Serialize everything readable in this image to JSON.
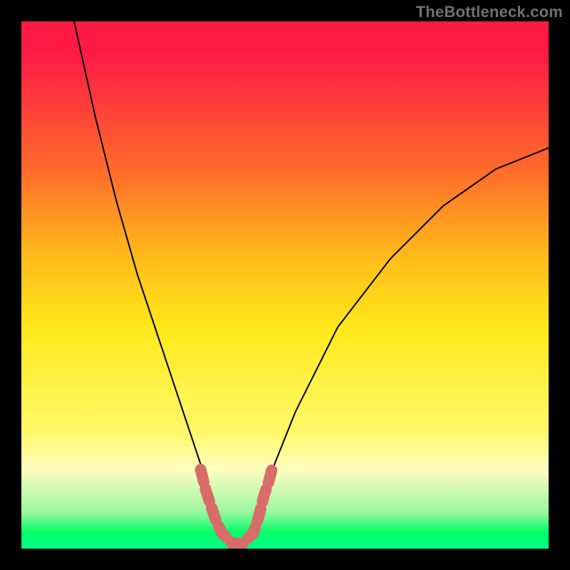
{
  "watermark": "TheBottleneck.com",
  "chart_data": {
    "type": "line",
    "title": "",
    "xlabel": "",
    "ylabel": "",
    "xlim": [
      0,
      100
    ],
    "ylim": [
      0,
      100
    ],
    "grid": false,
    "series": [
      {
        "name": "bottleneck-curve",
        "color": "#000000",
        "x": [
          10,
          14,
          18,
          22,
          26,
          30,
          32,
          34,
          36,
          37,
          38,
          39,
          40,
          41,
          42,
          43,
          44,
          46,
          48,
          52,
          60,
          70,
          80,
          90,
          100
        ],
        "y": [
          100,
          82,
          66,
          52,
          40,
          28,
          22,
          16,
          10,
          7,
          4,
          2,
          1,
          1,
          1,
          2,
          4,
          10,
          16,
          26,
          42,
          55,
          65,
          72,
          76
        ]
      }
    ],
    "markers": [
      {
        "name": "optimal-band",
        "color": "#d96b6b",
        "points": [
          {
            "x": 34,
            "y": 15
          },
          {
            "x": 35,
            "y": 11
          },
          {
            "x": 36,
            "y": 8
          },
          {
            "x": 37,
            "y": 5
          },
          {
            "x": 38,
            "y": 3
          },
          {
            "x": 39,
            "y": 2
          },
          {
            "x": 40,
            "y": 1
          },
          {
            "x": 41,
            "y": 1
          },
          {
            "x": 42,
            "y": 1
          },
          {
            "x": 43,
            "y": 2
          },
          {
            "x": 44,
            "y": 3
          },
          {
            "x": 45,
            "y": 6
          },
          {
            "x": 46,
            "y": 10
          },
          {
            "x": 47,
            "y": 13
          },
          {
            "x": 47.5,
            "y": 15
          }
        ]
      }
    ]
  }
}
